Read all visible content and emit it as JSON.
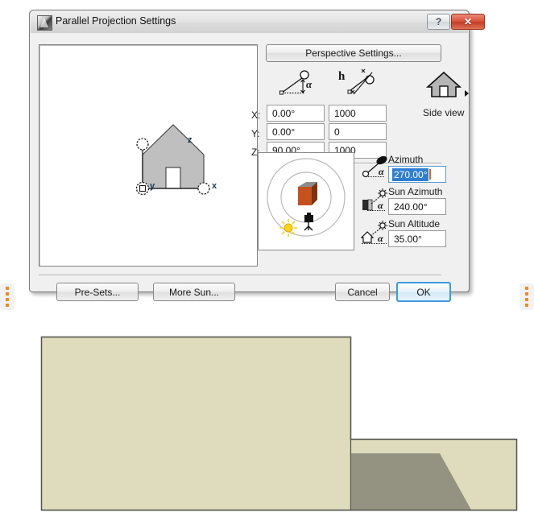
{
  "dialog": {
    "title": "Parallel Projection Settings",
    "app_icon": "archicad-logo-icon",
    "help_button": "?",
    "close_button": "✕",
    "perspective_button": "Perspective Settings...",
    "preview": {
      "axis_z": "z",
      "axis_y": "y",
      "axis_x": "x",
      "shape": "house-elevation-glyph"
    },
    "projection": {
      "angle_icon": "angle-alpha-icon",
      "distance_icon": "height-h-icon",
      "sideview_icon": "house-side-view-icon",
      "sideview_arrow": "chevron-right-icon",
      "sideview_label": "Side view",
      "rows": [
        {
          "label": "X:",
          "angle": "0.00°",
          "distance": "1000"
        },
        {
          "label": "Y:",
          "angle": "0.00°",
          "distance": "0"
        },
        {
          "label": "Z:",
          "angle": "90.00°",
          "distance": "1000"
        }
      ]
    },
    "compass": {
      "name": "sun-compass-widget",
      "building_icon": "building-block-icon",
      "sun_icon": "sun-icon",
      "camera_icon": "camera-tripod-icon",
      "building_color": "#c4521f",
      "building_top_color": "#8c8c8c",
      "sun_color": "#ffd21e"
    },
    "sun": {
      "fields": [
        {
          "label": "Azimuth",
          "value": "270.00°",
          "icon": "camera-angle-icon",
          "selected": true
        },
        {
          "label": "Sun Azimuth",
          "value": "240.00°",
          "icon": "sun-wall-angle-icon",
          "selected": false
        },
        {
          "label": "Sun Altitude",
          "value": "35.00°",
          "icon": "sun-house-angle-icon",
          "selected": false
        }
      ]
    },
    "footer": {
      "presets": "Pre-Sets...",
      "more_sun": "More Sun...",
      "cancel": "Cancel",
      "ok": "OK"
    }
  },
  "markers": {
    "left": "orange-dashed-marker",
    "right": "orange-dashed-marker",
    "color": "#f08a1e"
  },
  "elevation": {
    "name": "building-elevation-drawing",
    "wall_color": "#dedcbd",
    "shadow_color": "#949382",
    "outline_color": "#55544f"
  },
  "colors": {
    "accent": "#2f7fd0",
    "window_close": "#c13c27",
    "dialog_bg": "#f0f0f0"
  }
}
